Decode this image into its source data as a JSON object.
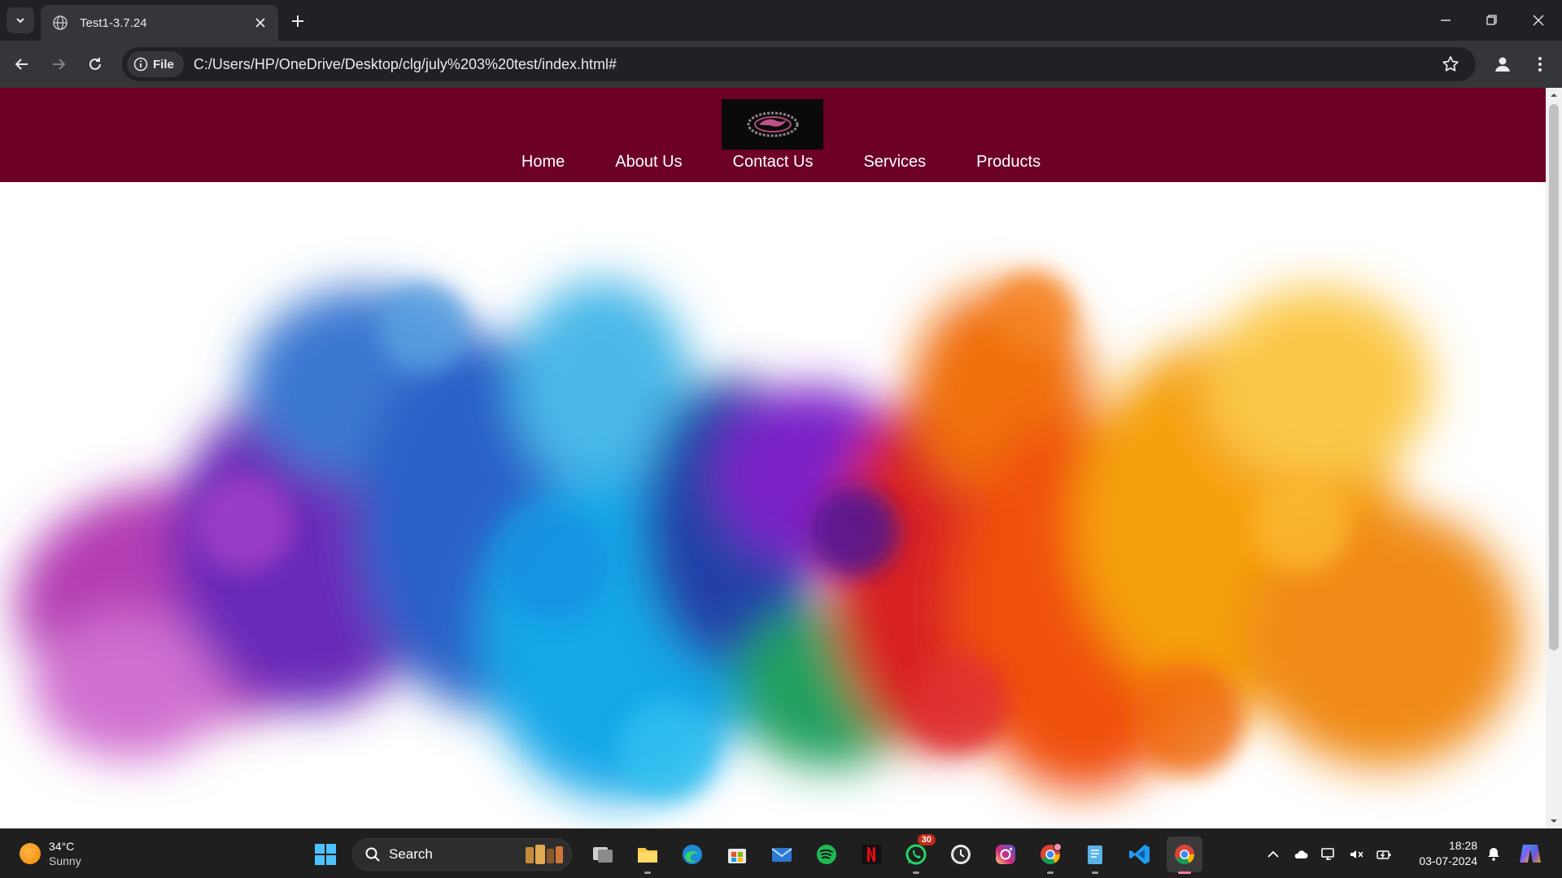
{
  "browser": {
    "tab_title": "Test1-3.7.24",
    "site_chip_label": "File",
    "url": "C:/Users/HP/OneDrive/Desktop/clg/july%203%20test/index.html#"
  },
  "site": {
    "nav": [
      "Home",
      "About Us",
      "Contact Us",
      "Services",
      "Products"
    ],
    "header_color": "#6c0027"
  },
  "taskbar": {
    "weather_temp": "34°C",
    "weather_condition": "Sunny",
    "search_label": "Search",
    "whatsapp_badge": "30",
    "time": "18:28",
    "date": "03-07-2024",
    "pinned_apps": [
      "windows-start",
      "search",
      "task-view",
      "file-explorer",
      "edge",
      "microsoft-store",
      "mail",
      "spotify",
      "netflix",
      "whatsapp",
      "clock",
      "instagram",
      "chrome-profile",
      "notepad",
      "vscode",
      "chrome"
    ]
  }
}
